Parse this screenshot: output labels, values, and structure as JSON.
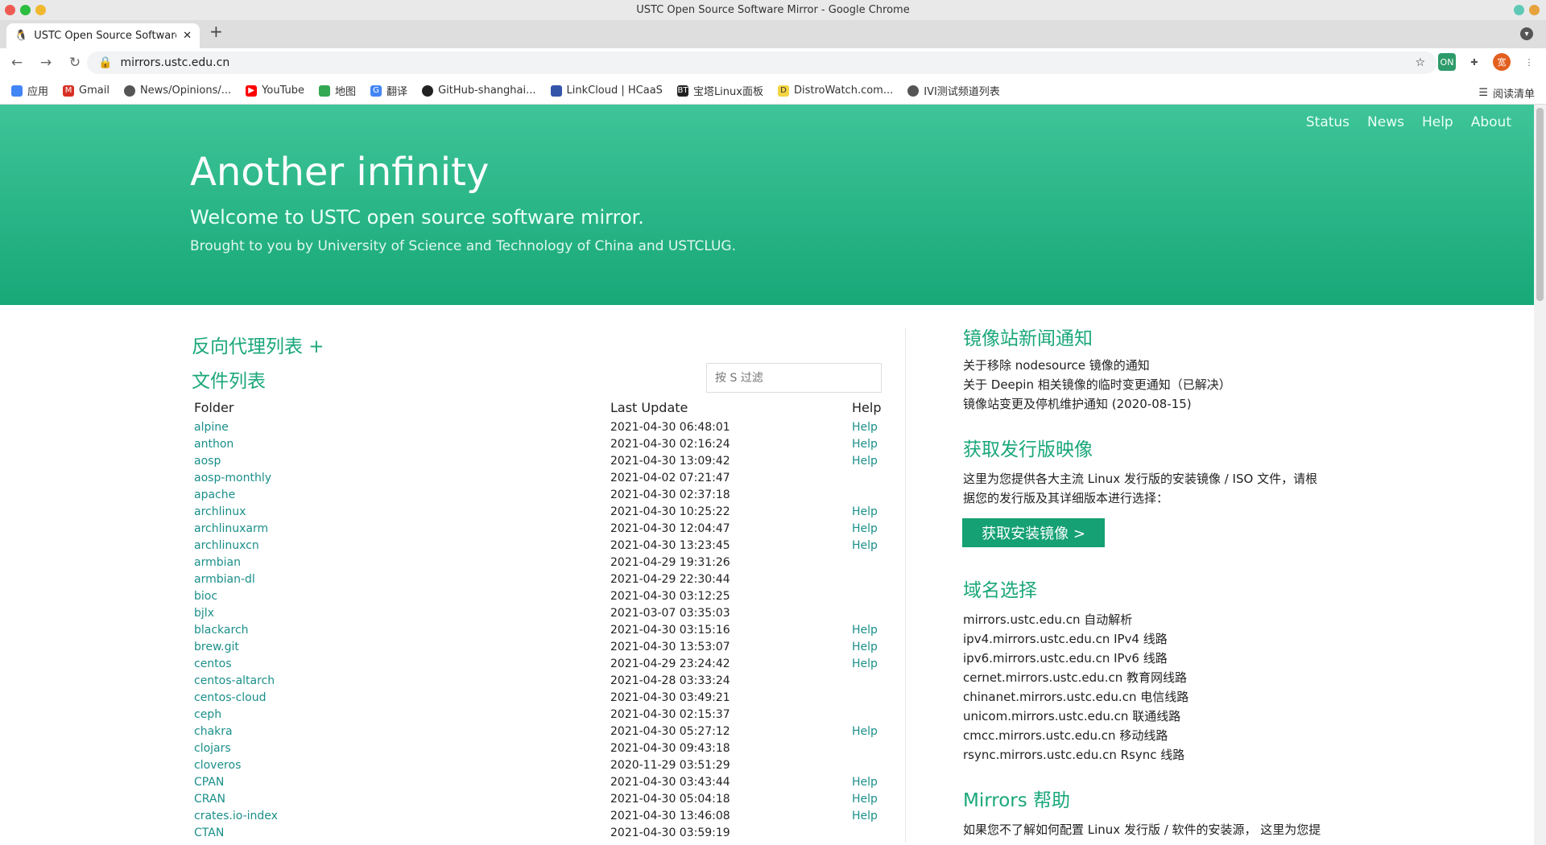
{
  "window": {
    "title": "USTC Open Source Software Mirror - Google Chrome"
  },
  "tab": {
    "title": "USTC Open Source Software Mirror"
  },
  "address": {
    "url": "mirrors.ustc.edu.cn"
  },
  "bookmarks": [
    "应用",
    "Gmail",
    "News/Opinions/...",
    "YouTube",
    "地图",
    "翻译",
    "GitHub-shanghai...",
    "LinkCloud | HCaaS",
    "宝塔Linux面板",
    "DistroWatch.com...",
    "IVI测试频道列表"
  ],
  "reading_list": "阅读清单",
  "nav": {
    "status": "Status",
    "news": "News",
    "help": "Help",
    "about": "About"
  },
  "hero": {
    "title": "Another infinity",
    "subtitle": "Welcome to USTC open source software mirror.",
    "credit": "Brought to you by University of Science and Technology of China and USTCLUG."
  },
  "left": {
    "proxy_heading": "反向代理列表 +",
    "files_heading": "文件列表",
    "filter_placeholder": "按 S 过滤",
    "col_folder": "Folder",
    "col_update": "Last Update",
    "col_help": "Help"
  },
  "rows": [
    {
      "name": "alpine",
      "date": "2021-04-30 06:48:01",
      "help": "Help"
    },
    {
      "name": "anthon",
      "date": "2021-04-30 02:16:24",
      "help": "Help"
    },
    {
      "name": "aosp",
      "date": "2021-04-30 13:09:42",
      "help": "Help"
    },
    {
      "name": "aosp-monthly",
      "date": "2021-04-02 07:21:47",
      "help": ""
    },
    {
      "name": "apache",
      "date": "2021-04-30 02:37:18",
      "help": ""
    },
    {
      "name": "archlinux",
      "date": "2021-04-30 10:25:22",
      "help": "Help"
    },
    {
      "name": "archlinuxarm",
      "date": "2021-04-30 12:04:47",
      "help": "Help"
    },
    {
      "name": "archlinuxcn",
      "date": "2021-04-30 13:23:45",
      "help": "Help"
    },
    {
      "name": "armbian",
      "date": "2021-04-29 19:31:26",
      "help": ""
    },
    {
      "name": "armbian-dl",
      "date": "2021-04-29 22:30:44",
      "help": ""
    },
    {
      "name": "bioc",
      "date": "2021-04-30 03:12:25",
      "help": ""
    },
    {
      "name": "bjlx",
      "date": "2021-03-07 03:35:03",
      "help": ""
    },
    {
      "name": "blackarch",
      "date": "2021-04-30 03:15:16",
      "help": "Help"
    },
    {
      "name": "brew.git",
      "date": "2021-04-30 13:53:07",
      "help": "Help"
    },
    {
      "name": "centos",
      "date": "2021-04-29 23:24:42",
      "help": "Help"
    },
    {
      "name": "centos-altarch",
      "date": "2021-04-28 03:33:24",
      "help": ""
    },
    {
      "name": "centos-cloud",
      "date": "2021-04-30 03:49:21",
      "help": ""
    },
    {
      "name": "ceph",
      "date": "2021-04-30 02:15:37",
      "help": ""
    },
    {
      "name": "chakra",
      "date": "2021-04-30 05:27:12",
      "help": "Help"
    },
    {
      "name": "clojars",
      "date": "2021-04-30 09:43:18",
      "help": ""
    },
    {
      "name": "cloveros",
      "date": "2020-11-29 03:51:29",
      "help": ""
    },
    {
      "name": "CPAN",
      "date": "2021-04-30 03:43:44",
      "help": "Help"
    },
    {
      "name": "CRAN",
      "date": "2021-04-30 05:04:18",
      "help": "Help"
    },
    {
      "name": "crates.io-index",
      "date": "2021-04-30 13:46:08",
      "help": "Help"
    },
    {
      "name": "CTAN",
      "date": "2021-04-30 03:59:19",
      "help": ""
    }
  ],
  "right": {
    "news_heading": "镜像站新闻通知",
    "news": [
      "关于移除 nodesource 镜像的通知",
      "关于 Deepin 相关镜像的临时变更通知（已解决）",
      "镜像站变更及停机维护通知 (2020-08-15)"
    ],
    "iso_heading": "获取发行版映像",
    "iso_text": [
      "这里为您提供各大主流 Linux 发行版的安装镜像 / ISO 文件，请根",
      "据您的发行版及其详细版本进行选择："
    ],
    "iso_button": "获取安装镜像 >",
    "domain_heading": "域名选择",
    "domains": [
      "mirrors.ustc.edu.cn 自动解析",
      "ipv4.mirrors.ustc.edu.cn IPv4 线路",
      "ipv6.mirrors.ustc.edu.cn IPv6 线路",
      "cernet.mirrors.ustc.edu.cn 教育网线路",
      "chinanet.mirrors.ustc.edu.cn 电信线路",
      "unicom.mirrors.ustc.edu.cn 联通线路",
      "cmcc.mirrors.ustc.edu.cn 移动线路",
      "rsync.mirrors.ustc.edu.cn Rsync 线路"
    ],
    "help_heading": "Mirrors 帮助",
    "help_text": "如果您不了解如何配置 Linux 发行版 / 软件的安装源， 这里为您提"
  }
}
